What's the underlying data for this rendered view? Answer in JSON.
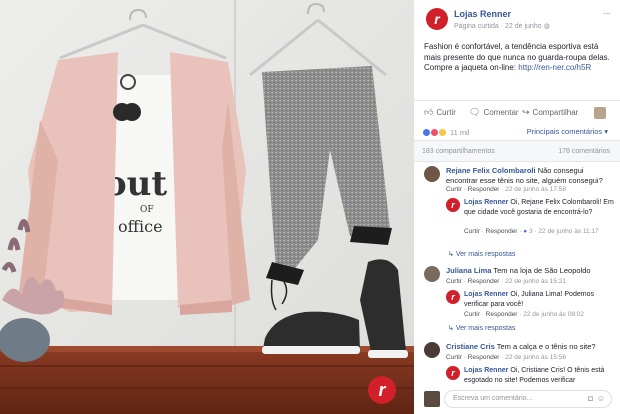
{
  "page": {
    "name": "Lojas Renner",
    "type": "Página curtida",
    "date": "22 de junho",
    "separator": "·"
  },
  "post": {
    "text": "Fashion é confortável, a tendência esportiva está mais presente do que nunca no guarda-roupa delas. Compre a jaqueta on-line:",
    "link": "http://ren-ner.co/h5R"
  },
  "actions": {
    "like": "Curtir",
    "comment": "Comentar",
    "share": "Compartilhar"
  },
  "reactions": {
    "count": "11 mil",
    "top": "Principais comentários ▾"
  },
  "counts": {
    "shares": "183 compartilhamentos",
    "comments": "178 comentários"
  },
  "photo": {
    "brand_mark": "r"
  },
  "comments": [
    {
      "author": "Rejane Felix Colombaroli",
      "text": "Não consegui encontrar esse tênis no site, alguém consegui?",
      "like": "Curtir",
      "reply": "Responder",
      "time": "22 de junho às 17:58"
    },
    {
      "author": "Lojas Renner",
      "text": "Oi, Rejane Felix Colombaroli! Em que cidade você gostaria de encontrá-lo?",
      "like": "Curtir",
      "reply": "Responder",
      "likes": "3",
      "time": "22 de junho às 11:17",
      "more": "Ver mais respostas"
    },
    {
      "author": "Juliana Lima",
      "text": "Tem na loja de São Leopoldo",
      "like": "Curtir",
      "reply": "Responder",
      "time": "22 de junho às 15:21"
    },
    {
      "author": "Lojas Renner",
      "text": "Oi, Juliana Lima! Podemos verificar para você!",
      "like": "Curtir",
      "reply": "Responder",
      "time": "22 de junho às 08:02",
      "more": "Ver mais respostas"
    },
    {
      "author": "Cristiane Cris",
      "text": "Tem a calça e o tênis no site?",
      "like": "Curtir",
      "reply": "Responder",
      "time": "22 de junho às 15:56"
    },
    {
      "author": "Lojas Renner",
      "text": "Oi, Cristiane Cris! O tênis está esgotado no site! Podemos verificar"
    }
  ],
  "input": {
    "placeholder": "Escreva um comentário..."
  },
  "colors": {
    "brand": "#d2202a",
    "link": "#365899",
    "muted": "#90949c"
  }
}
